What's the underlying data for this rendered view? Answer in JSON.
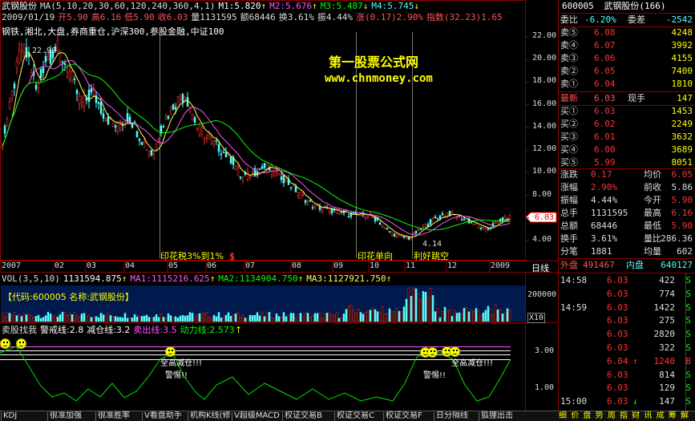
{
  "stock": {
    "name": "武钢股份",
    "code": "600005",
    "count_label": "(166)"
  },
  "ma_line": {
    "name": "武钢股份",
    "ma_params": "MA(5,10,20,30,60,120,240,360,4,1)",
    "m1": "M1:5.820",
    "m2": "M2:5.676",
    "m3": "M3:5.487",
    "m4": "M4:5.745"
  },
  "info_line": {
    "date": "2009/01/19",
    "open": "开5.90",
    "high": "高6.16",
    "low": "低5.90",
    "close": "收6.03",
    "vol": "量1131595",
    "amt": "额68446",
    "turn": "换3.61%",
    "amp": "振4.44%",
    "chg": "涨(0.17)2.90%",
    "index": "指数(32.23)1.65"
  },
  "sector_line": "钢铁,湘北,大盘,券商重仓,沪深300,参股金融,中证100",
  "watermark": {
    "title": "第一股票公式网",
    "url": "www.chnmoney.com"
  },
  "price_axis": {
    "labels": [
      "22.00",
      "20.00",
      "18.00",
      "16.00",
      "14.00",
      "12.00",
      "10.00",
      "8.00",
      "6.00",
      "4.00"
    ],
    "current": "6.03"
  },
  "peak_label": "22.98",
  "low_label": "4.14",
  "events": [
    {
      "text": "印花税3%到1%"
    },
    {
      "text": "$"
    },
    {
      "text": "印花单向"
    },
    {
      "text": "利好跳空"
    }
  ],
  "months": [
    "2007",
    "02",
    "03",
    "04",
    "05",
    "06",
    "07",
    "08",
    "09",
    "10",
    "11",
    "12",
    "2009"
  ],
  "period_label": "日线",
  "chart_data": [
    {
      "type": "line",
      "name": "price",
      "x": [
        "2007",
        "02",
        "03",
        "04",
        "05",
        "06",
        "07",
        "08",
        "09",
        "10",
        "11",
        "12",
        "2009"
      ],
      "y_range": [
        4.0,
        22.0
      ],
      "ma": [
        {
          "name": "M1",
          "value": 5.82
        },
        {
          "name": "M2",
          "value": 5.676
        },
        {
          "name": "M3",
          "value": 5.487
        },
        {
          "name": "M4",
          "value": 5.745
        }
      ],
      "peak": 22.98,
      "low": 4.14,
      "last": 6.03
    },
    {
      "type": "bar",
      "name": "volume",
      "ticks": [
        "200000"
      ]
    },
    {
      "type": "line",
      "name": "indicator",
      "ticks": [
        "3.00",
        "1.00"
      ]
    }
  ],
  "vol_line": {
    "title": "VOL(3,5,10)",
    "v": "1131594.875",
    "ma1": "MA1:1115216.625",
    "ma2": "MA2:1134904.750",
    "ma3": "MA3:1127921.750"
  },
  "vol_title": "【代码:600005 名称:武钢股份】",
  "vol_axis": {
    "label": "200000",
    "unit": "X10"
  },
  "ind_line": {
    "title": "卖股找我",
    "warn": "警戒线:2.8",
    "dec": "减仓线:3.2",
    "sell": "卖出线:3.5",
    "power": "动力线:2.573"
  },
  "ind_axis": [
    "3.00",
    "1.00"
  ],
  "ind_notes": {
    "left1": "全高减仓!!!",
    "left2": "警惕!!",
    "right1": "全高减仓!!!",
    "right2": "警惕!!"
  },
  "weibi": {
    "label": "委比",
    "value": "-6.20%",
    "diff_label": "委差",
    "diff_value": "-2542"
  },
  "sells": [
    {
      "label": "卖⑤",
      "price": "6.08",
      "vol": "4248"
    },
    {
      "label": "卖④",
      "price": "6.07",
      "vol": "3992"
    },
    {
      "label": "卖③",
      "price": "6.06",
      "vol": "4155"
    },
    {
      "label": "卖②",
      "price": "6.05",
      "vol": "7400"
    },
    {
      "label": "卖①",
      "price": "6.04",
      "vol": "1810"
    }
  ],
  "latest": {
    "label": "最新",
    "price": "6.03",
    "hand_label": "现手",
    "hand": "147"
  },
  "buys": [
    {
      "label": "买①",
      "price": "6.03",
      "vol": "1453"
    },
    {
      "label": "买②",
      "price": "6.02",
      "vol": "2249"
    },
    {
      "label": "买③",
      "price": "6.01",
      "vol": "3632"
    },
    {
      "label": "买④",
      "price": "6.00",
      "vol": "3689"
    },
    {
      "label": "买⑤",
      "price": "5.99",
      "vol": "8051"
    }
  ],
  "stats": [
    {
      "l1": "涨跌",
      "v1": "0.17",
      "l2": "均价",
      "v2": "6.05"
    },
    {
      "l1": "涨幅",
      "v1": "2.90%",
      "l2": "前收",
      "v2": "5.86"
    },
    {
      "l1": "振幅",
      "v1": "4.44%",
      "l2": "今开",
      "v2": "5.90"
    },
    {
      "l1": "总手",
      "v1": "1131595",
      "l2": "最高",
      "v2": "6.16"
    },
    {
      "l1": "总额",
      "v1": "68446",
      "l2": "最低",
      "v2": "5.90"
    },
    {
      "l1": "换手",
      "v1": "3.61%",
      "l2": "量比",
      "v2": "286.36"
    },
    {
      "l1": "分笔",
      "v1": "1881",
      "l2": "均量",
      "v2": "602"
    }
  ],
  "pan": {
    "out_label": "外盘",
    "out": "491467",
    "in_label": "内盘",
    "in": "640127"
  },
  "ticks": [
    {
      "time": "14:58",
      "price": "6.03",
      "vol": "422",
      "flag": "S"
    },
    {
      "time": "",
      "price": "6.03",
      "vol": "774",
      "flag": "S"
    },
    {
      "time": "14:59",
      "price": "6.03",
      "vol": "1422",
      "flag": "S"
    },
    {
      "time": "",
      "price": "6.03",
      "vol": "275",
      "flag": "S"
    },
    {
      "time": "",
      "price": "6.03",
      "vol": "2820",
      "flag": "S"
    },
    {
      "time": "",
      "price": "6.03",
      "vol": "322",
      "flag": "S"
    },
    {
      "time": "",
      "price": "6.04",
      "arrow": "↑",
      "vol": "1240",
      "flag": "B"
    },
    {
      "time": "",
      "price": "6.03",
      "vol": "814",
      "flag": "S"
    },
    {
      "time": "",
      "price": "6.03",
      "vol": "129",
      "flag": "S"
    },
    {
      "time": "15:00",
      "price": "6.03",
      "arrow": "↓",
      "vol": "147",
      "flag": "S"
    }
  ],
  "tabs": [
    "KDJ",
    "很准加强",
    "很准胜率",
    "V看盘助手",
    "机构K线(修",
    "V超级MACD",
    "权证交易B",
    "权证交易C",
    "权证交易F",
    "日分隔线",
    "狐狸出击"
  ],
  "right_tabs": [
    "细",
    "价",
    "盘",
    "势",
    "周",
    "指",
    "财",
    "讯",
    "成",
    "筹",
    "解"
  ],
  "colors": {
    "up": "#ff3232",
    "down": "#54fcfc",
    "label": "#ff5555",
    "yellow": "#ffff00",
    "border": "#8b0000"
  }
}
